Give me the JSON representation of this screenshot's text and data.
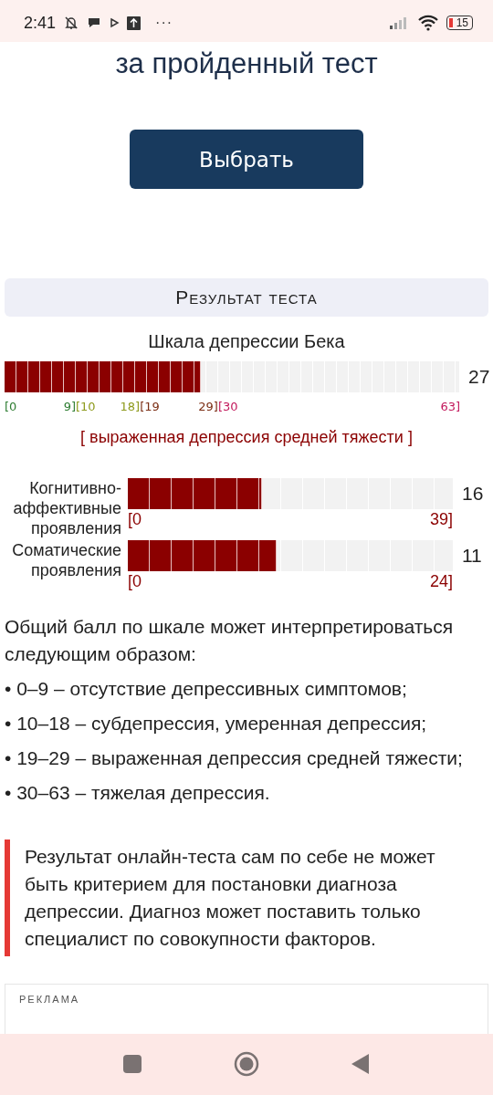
{
  "status_bar": {
    "time": "2:41",
    "more": "···",
    "battery": "15"
  },
  "heading": "за пройденный тест",
  "choose_button": "Выбрать",
  "result": {
    "title": "Результат теста",
    "scale_title": "Шкала депрессии Бека",
    "main": {
      "level": 0.43,
      "score": "27"
    },
    "ranges": [
      {
        "start": "[0",
        "end": "9]",
        "color": "#2e7d32"
      },
      {
        "start": "[10",
        "end": "18]",
        "color": "#8d9a1c"
      },
      {
        "start": "[19",
        "end": "29]",
        "color": "#7b2e14"
      },
      {
        "start": "[30",
        "end": "63]",
        "color": "#c2185b"
      }
    ],
    "verdict": "[ выраженная депрессия средней тяжести ]",
    "subscales": [
      {
        "label": "Когнитивно-аффективные проявления",
        "level": 0.41,
        "score": "16",
        "min": "[0",
        "max": "39]"
      },
      {
        "label": "Соматические проявления",
        "level": 0.455,
        "score": "11",
        "min": "[0",
        "max": "24]"
      }
    ]
  },
  "interpretation": {
    "intro": "Общий балл по шкале может интерпретироваться следующим образом:",
    "items": [
      "• 0–9 – отсутствие депрессивных симптомов;",
      "• 10–18 – субдепрессия, умеренная депрессия;",
      "• 19–29 – выраженная депрессия средней тяжести;",
      "• 30–63 – тяжелая депрессия."
    ]
  },
  "note": "Результат онлайн-теста сам по себе не может быть критерием для постановки диагноза депрессии. Диагноз может поставить только специалист по совокупности факторов.",
  "ad": {
    "label": "РЕКЛАМА"
  }
}
